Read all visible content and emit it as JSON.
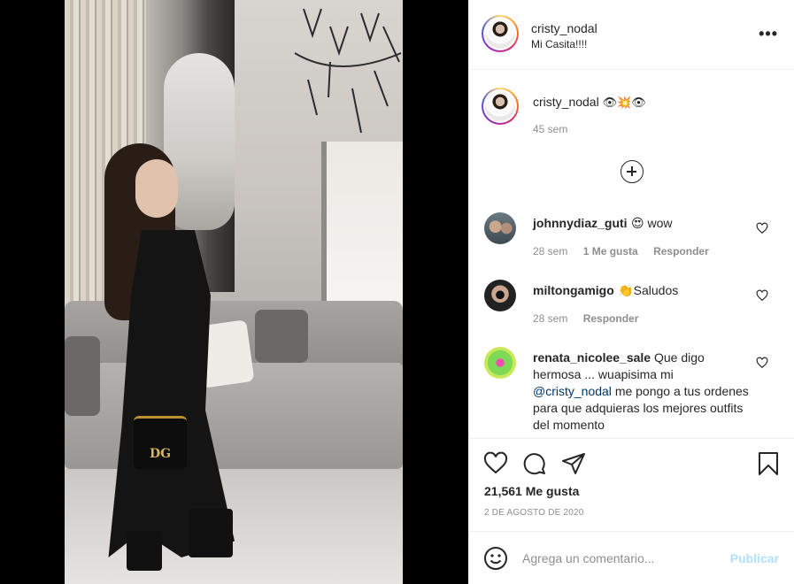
{
  "post": {
    "username": "cristy_nodal",
    "location": "Mi Casita!!!!",
    "more_icon": "•••",
    "caption": {
      "username": "cristy_nodal",
      "emojis": "👁💥👁",
      "time": "45 sem"
    },
    "comments": [
      {
        "username": "johnnydiaz_guti",
        "text": "😍 wow",
        "time": "28 sem",
        "likes": "1 Me gusta",
        "reply": "Responder"
      },
      {
        "username": "miltongamigo",
        "text": "👏Saludos",
        "time": "28 sem",
        "reply": "Responder"
      },
      {
        "username": "renata_nicolee_sale",
        "text_before": "Que digo hermosa ... wuapisima mi",
        "mention": "@cristy_nodal",
        "text_after": "me pongo a tus ordenes para que adquieras los mejores outfits del momento"
      }
    ],
    "like_count": "21,561 Me gusta",
    "date": "2 DE AGOSTO DE 2020"
  },
  "composer": {
    "placeholder": "Agrega un comentario...",
    "publish_label": "Publicar"
  },
  "photo": {
    "bag_logo": "DG"
  },
  "icons": [
    "more-options-icon",
    "load-more-icon",
    "heart-icon",
    "comment-icon",
    "share-icon",
    "save-icon",
    "emoji-icon"
  ]
}
